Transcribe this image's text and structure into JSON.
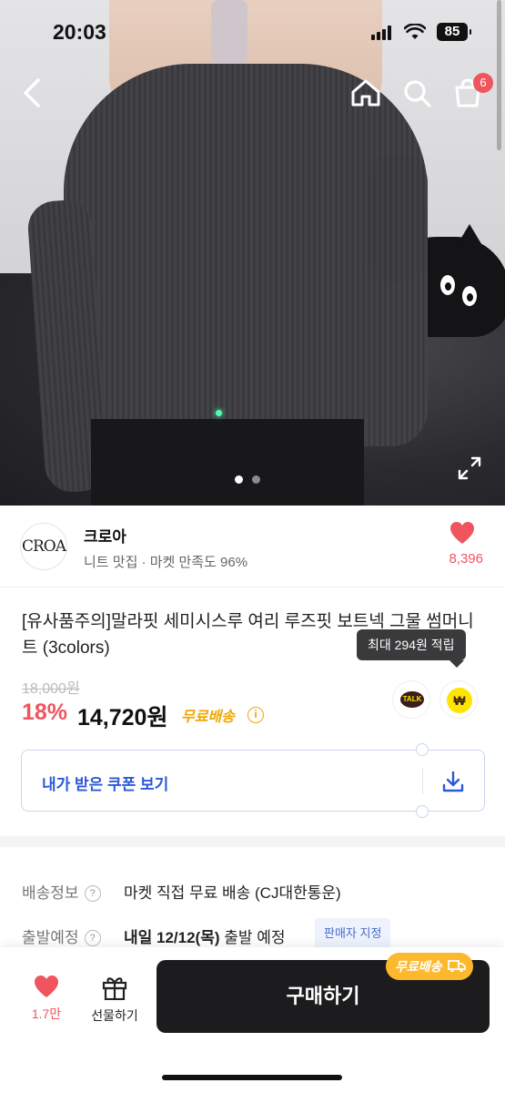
{
  "status_bar": {
    "time": "20:03",
    "battery": "85"
  },
  "hero": {
    "pagination": {
      "total": 2,
      "active": 1
    },
    "cart_badge": "6"
  },
  "seller": {
    "logo_text": "CROA",
    "name": "크로아",
    "meta": "니트 맛집 · 마켓 만족도 96%",
    "likes": "8,396"
  },
  "product": {
    "title": "[유사품주의]말라핏 세미시스루 여리 루즈핏 보트넥 그물 썸머니트 (3colors)",
    "tooltip": "최대 294원 적립",
    "original_price": "18,000원",
    "discount": "18%",
    "price": "14,720원",
    "free_shipping": "무료배송",
    "info_symbol": "i",
    "kakao_talk": "TALK",
    "kakao_pay": "₩"
  },
  "coupon": {
    "label": "내가 받은 쿠폰 보기"
  },
  "shipping": {
    "label": "배송정보",
    "help": "?",
    "value": "마켓 직접 무료 배송 (CJ대한통운)"
  },
  "departure": {
    "label": "출발예정",
    "help": "?",
    "value_bold": "내일 12/12(목)",
    "value_rest": " 출발 예정",
    "tag": "판매자 지정"
  },
  "bottom_bar": {
    "like_count": "1.7만",
    "gift_label": "선물하기",
    "buy_label": "구매하기",
    "buy_badge": "무료배송"
  },
  "colors": {
    "accent_red": "#f0545f",
    "accent_yellow": "#fdb92d",
    "coupon_blue": "#2c5ad6",
    "dark_button": "#1c1c1e"
  }
}
